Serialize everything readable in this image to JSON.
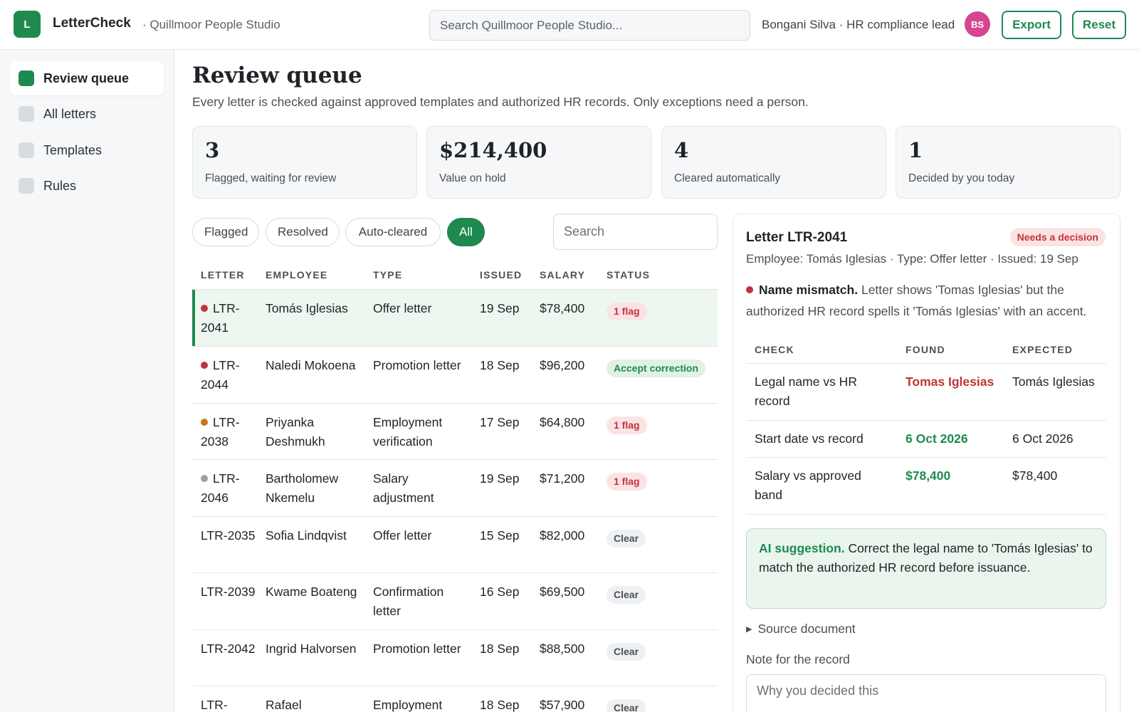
{
  "header": {
    "logo_letter": "L",
    "app_name": "LetterCheck",
    "workspace": "· Quillmoor People Studio",
    "search_placeholder": "Search Quillmoor People Studio...",
    "user_label": "Bongani Silva · HR compliance lead",
    "avatar_initials": "BS",
    "export_label": "Export",
    "reset_label": "Reset"
  },
  "sidebar": {
    "items": [
      {
        "label": "Review queue",
        "active": true
      },
      {
        "label": "All letters",
        "active": false
      },
      {
        "label": "Templates",
        "active": false
      },
      {
        "label": "Rules",
        "active": false
      }
    ]
  },
  "main": {
    "title": "Review queue",
    "subtitle": "Every letter is checked against approved templates and authorized HR records. Only exceptions need a person.",
    "stats": [
      {
        "value": "3",
        "label": "Flagged, waiting for review"
      },
      {
        "value": "$214,400",
        "label": "Value on hold"
      },
      {
        "value": "4",
        "label": "Cleared automatically"
      },
      {
        "value": "1",
        "label": "Decided by you today"
      }
    ],
    "filters": [
      {
        "label": "Flagged",
        "active": false
      },
      {
        "label": "Resolved",
        "active": false
      },
      {
        "label": "Auto-cleared",
        "active": false
      },
      {
        "label": "All",
        "active": true
      }
    ],
    "list_search_placeholder": "Search"
  },
  "table": {
    "columns": [
      "LETTER",
      "EMPLOYEE",
      "TYPE",
      "ISSUED",
      "SALARY",
      "STATUS"
    ],
    "rows": [
      {
        "letter": "LTR-2041",
        "employee": "Tomás Iglesias",
        "type": "Offer letter",
        "issued": "19 Sep",
        "salary": "$78,400",
        "status": "1 flag",
        "status_kind": "flag",
        "dot_color": "#c0353a",
        "selected": true
      },
      {
        "letter": "LTR-2044",
        "employee": "Naledi Mokoena",
        "type": "Promotion letter",
        "issued": "18 Sep",
        "salary": "$96,200",
        "status": "Accept correction",
        "status_kind": "accept",
        "dot_color": "#c0353a",
        "selected": false
      },
      {
        "letter": "LTR-2038",
        "employee": "Priyanka Deshmukh",
        "type": "Employment verification",
        "issued": "17 Sep",
        "salary": "$64,800",
        "status": "1 flag",
        "status_kind": "flag",
        "dot_color": "#c8741a",
        "selected": false
      },
      {
        "letter": "LTR-2046",
        "employee": "Bartholomew Nkemelu",
        "type": "Salary adjustment",
        "issued": "19 Sep",
        "salary": "$71,200",
        "status": "1 flag",
        "status_kind": "flag",
        "dot_color": "#9aa0a6",
        "selected": false
      },
      {
        "letter": "LTR-2035",
        "employee": "Sofia Lindqvist",
        "type": "Offer letter",
        "issued": "15 Sep",
        "salary": "$82,000",
        "status": "Clear",
        "status_kind": "clear",
        "dot_color": "",
        "selected": false
      },
      {
        "letter": "LTR-2039",
        "employee": "Kwame Boateng",
        "type": "Confirmation letter",
        "issued": "16 Sep",
        "salary": "$69,500",
        "status": "Clear",
        "status_kind": "clear",
        "dot_color": "",
        "selected": false
      },
      {
        "letter": "LTR-2042",
        "employee": "Ingrid Halvorsen",
        "type": "Promotion letter",
        "issued": "18 Sep",
        "salary": "$88,500",
        "status": "Clear",
        "status_kind": "clear",
        "dot_color": "",
        "selected": false
      },
      {
        "letter": "LTR-",
        "employee": "Rafael",
        "type": "Employment",
        "issued": "18 Sep",
        "salary": "$57,900",
        "status": "Clear",
        "status_kind": "clear",
        "dot_color": "",
        "selected": false
      }
    ]
  },
  "detail": {
    "title": "Letter LTR-2041",
    "badge": "Needs a decision",
    "meta": "Employee: Tomás Iglesias · Type: Offer letter · Issued: 19 Sep",
    "issue_title": "Name mismatch.",
    "issue_text": "Letter shows 'Tomas Iglesias' but the authorized HR record spells it 'Tomás Iglesias' with an accent.",
    "check_columns": [
      "CHECK",
      "FOUND",
      "EXPECTED"
    ],
    "checks": [
      {
        "check": "Legal name vs HR record",
        "found": "Tomas Iglesias",
        "expected": "Tomás Iglesias",
        "ok": false
      },
      {
        "check": "Start date vs record",
        "found": "6 Oct 2026",
        "expected": "6 Oct 2026",
        "ok": true
      },
      {
        "check": "Salary vs approved band",
        "found": "$78,400",
        "expected": "$78,400",
        "ok": true
      }
    ],
    "ai_label": "AI suggestion.",
    "ai_text": "Correct the legal name to 'Tomás Iglesias' to match the authorized HR record before issuance.",
    "source_label": "Source document",
    "note_label": "Note for the record",
    "note_placeholder": "Why you decided this"
  },
  "colors": {
    "accent": "#1f8a50",
    "danger": "#c0353a",
    "warning": "#c8741a",
    "avatar": "#d64590"
  }
}
